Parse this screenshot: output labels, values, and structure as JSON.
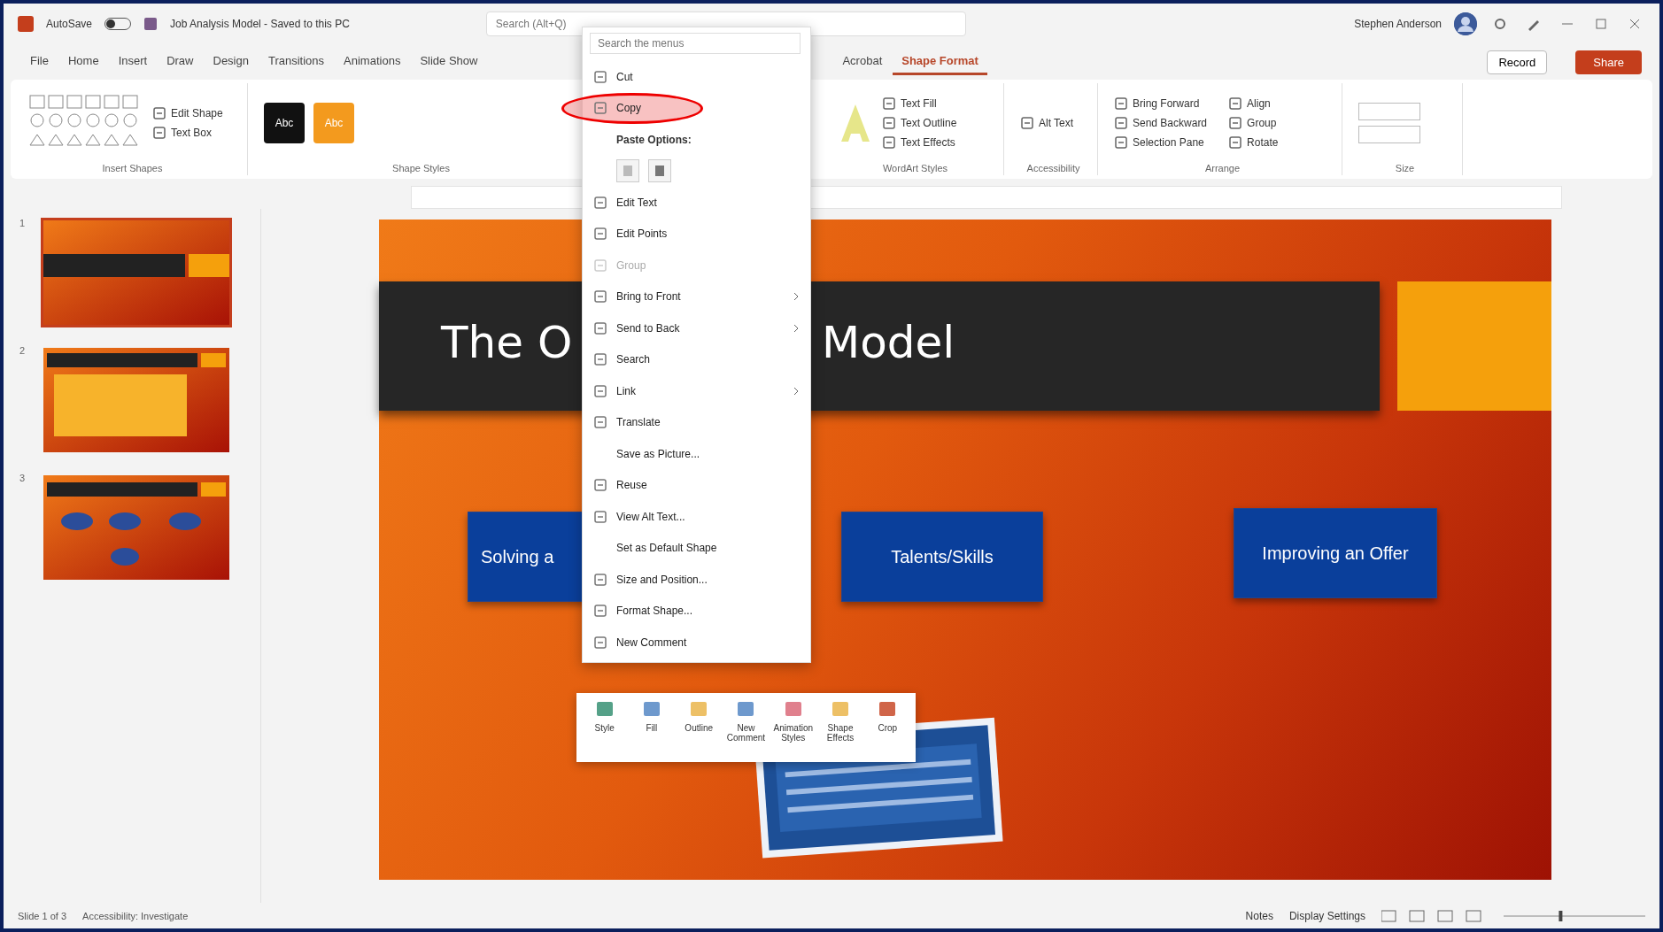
{
  "title_bar": {
    "autosave": "AutoSave",
    "autosave_on": false,
    "file_title": "Job Analysis Model - Saved to this PC",
    "search_placeholder": "Search (Alt+Q)",
    "user": "Stephen Anderson"
  },
  "tabs": [
    {
      "label": "File",
      "selected": false
    },
    {
      "label": "Home",
      "selected": false
    },
    {
      "label": "Insert",
      "selected": false
    },
    {
      "label": "Draw",
      "selected": false
    },
    {
      "label": "Design",
      "selected": false
    },
    {
      "label": "Transitions",
      "selected": false
    },
    {
      "label": "Animations",
      "selected": false
    },
    {
      "label": "Slide Show",
      "selected": false
    },
    {
      "label": "Acrobat",
      "selected": false
    },
    {
      "label": "Shape Format",
      "selected": true
    }
  ],
  "record": "Record",
  "share": "Share",
  "ribbon": [
    {
      "label": "Insert Shapes",
      "items": [
        "Edit Shape",
        "Text Box"
      ]
    },
    {
      "label": "Shape Styles",
      "swatches": [
        {
          "label": "Abc",
          "color": "#111111"
        },
        {
          "label": "Abc",
          "color": "#f39a1e"
        }
      ]
    },
    {
      "label": "WordArt Styles",
      "items": [
        "Text Fill",
        "Text Outline",
        "Text Effects"
      ]
    },
    {
      "label": "Accessibility",
      "items": [
        "Alt Text"
      ]
    },
    {
      "label": "Arrange",
      "items": [
        "Bring Forward",
        "Send Backward",
        "Selection Pane",
        "Align",
        "Group",
        "Rotate"
      ]
    },
    {
      "label": "Size"
    }
  ],
  "thumbnails": [
    {
      "number": "1",
      "selected": true
    },
    {
      "number": "2",
      "selected": false
    },
    {
      "number": "3",
      "selected": false
    }
  ],
  "slide": {
    "title_left": "The O",
    "title_right": "Model",
    "boxes": [
      "Solving a",
      "Talents/Skills",
      "Improving an Offer"
    ]
  },
  "context_menu": {
    "search_placeholder": "Search the menus",
    "top_items": [
      {
        "label": "Cut",
        "kind": "item",
        "disabled": false,
        "submenu": false,
        "highlighted": false
      },
      {
        "label": "Copy",
        "kind": "item",
        "disabled": false,
        "submenu": false,
        "highlighted": true
      }
    ],
    "paste_label": "Paste Options:",
    "items": [
      {
        "label": "Edit Text",
        "kind": "item",
        "disabled": false,
        "submenu": false,
        "highlighted": false
      },
      {
        "label": "Edit Points",
        "kind": "item",
        "disabled": false,
        "submenu": false,
        "highlighted": false
      },
      {
        "label": "Group",
        "kind": "item",
        "disabled": true,
        "submenu": false,
        "highlighted": false
      },
      {
        "label": "Bring to Front",
        "kind": "item",
        "disabled": false,
        "submenu": true,
        "highlighted": false
      },
      {
        "label": "Send to Back",
        "kind": "item",
        "disabled": false,
        "submenu": true,
        "highlighted": false
      },
      {
        "label": "Search",
        "kind": "item",
        "disabled": false,
        "submenu": false,
        "highlighted": false
      },
      {
        "label": "Link",
        "kind": "item",
        "disabled": false,
        "submenu": true,
        "highlighted": false
      },
      {
        "label": "Translate",
        "kind": "item",
        "disabled": false,
        "submenu": false,
        "highlighted": false
      },
      {
        "label": "Save as Picture...",
        "kind": "plain",
        "disabled": false,
        "submenu": false,
        "highlighted": false
      },
      {
        "label": "Reuse",
        "kind": "item",
        "disabled": false,
        "submenu": false,
        "highlighted": false
      },
      {
        "label": "View Alt Text...",
        "kind": "item",
        "disabled": false,
        "submenu": false,
        "highlighted": false
      },
      {
        "label": "Set as Default Shape",
        "kind": "plain",
        "disabled": false,
        "submenu": false,
        "highlighted": false
      },
      {
        "label": "Size and Position...",
        "kind": "item",
        "disabled": false,
        "submenu": false,
        "highlighted": false
      },
      {
        "label": "Format Shape...",
        "kind": "item",
        "disabled": false,
        "submenu": false,
        "highlighted": false
      },
      {
        "label": "New Comment",
        "kind": "item",
        "disabled": false,
        "submenu": false,
        "highlighted": false
      }
    ]
  },
  "mini_toolbar": [
    "Style",
    "Fill",
    "Outline",
    "New Comment",
    "Animation Styles",
    "Shape Effects",
    "Crop"
  ],
  "status_bar": {
    "slide": "Slide 1 of 3",
    "accessibility": "Accessibility: Investigate",
    "notes": "Notes",
    "display": "Display Settings",
    "zoom_slider": {
      "level": 0.4
    }
  }
}
